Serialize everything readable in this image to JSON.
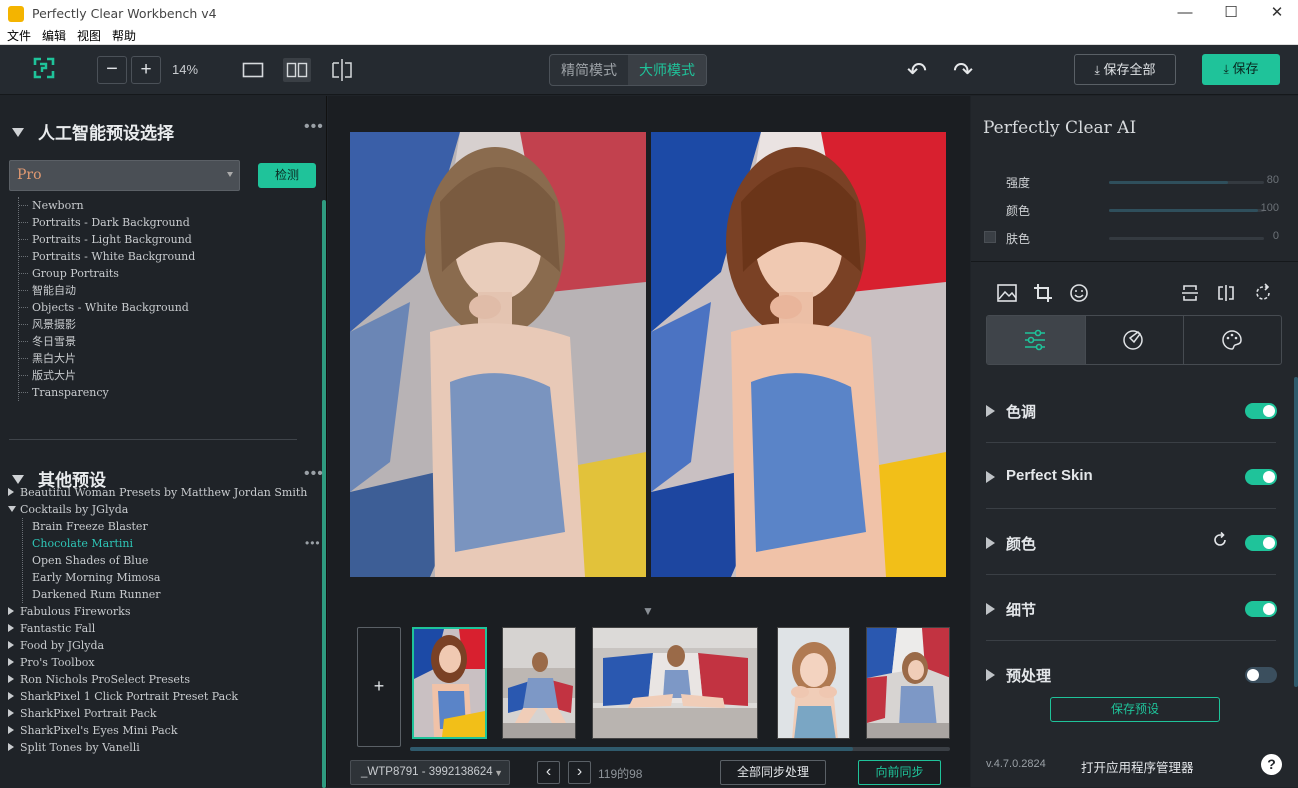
{
  "window": {
    "title": "Perfectly Clear Workbench v4",
    "minimize": "—",
    "maximize": "☐",
    "close": "✕"
  },
  "menu": [
    "文件",
    "编辑",
    "视图",
    "帮助"
  ],
  "toolbar": {
    "zoom_out": "−",
    "zoom_in": "+",
    "zoom_level": "14%",
    "mode_simple": "精简模式",
    "mode_master": "大师模式",
    "save_all": "保存全部",
    "save": "保存",
    "undo": "↶",
    "redo": "↷"
  },
  "left": {
    "ai_title": "人工智能预设选择",
    "preset_select": "Pro",
    "detect": "检测",
    "ai_presets": [
      "Newborn",
      "Portraits - Dark Background",
      "Portraits - Light Background",
      "Portraits - White Background",
      "Group Portraits",
      "智能自动",
      "Objects - White Background",
      "风景摄影",
      "冬日雪景",
      "黑白大片",
      "版式大片",
      "Transparency"
    ],
    "other_title": "其他预设",
    "groups_before": [
      "Beautiful Woman Presets by Matthew Jordan Smith"
    ],
    "expanded_group": "Cocktails by JGlyda",
    "expanded_items": [
      "Brain Freeze Blaster",
      "Chocolate Martini",
      "Open Shades of Blue",
      "Early Morning Mimosa",
      "Darkened Rum Runner"
    ],
    "groups_after": [
      "Fabulous Fireworks",
      "Fantastic Fall",
      "Food by JGlyda",
      "Pro's Toolbox",
      "Ron Nichols ProSelect Presets",
      "SharkPixel 1 Click Portrait Preset Pack",
      "SharkPixel Portrait Pack",
      "SharkPixel's Eyes Mini Pack",
      "Split Tones by Vanelli"
    ],
    "dots": "•••"
  },
  "center": {
    "add": "+",
    "file_select": "_WTP8791 - 3992138624",
    "prev": "‹",
    "next": "›",
    "counter": "119的98",
    "sync_all": "全部同步处理",
    "sync_forward": "向前同步",
    "collapse": "▼"
  },
  "right": {
    "title": "Perfectly Clear AI",
    "sliders": [
      {
        "label": "强度",
        "value": "80",
        "level": 0.8
      },
      {
        "label": "颜色",
        "value": "100",
        "level": 1.0
      },
      {
        "label": "肤色",
        "value": "0",
        "level": 0.0
      }
    ],
    "sections": [
      {
        "name": "色调",
        "on": true
      },
      {
        "name": "Perfect Skin",
        "on": true
      },
      {
        "name": "颜色",
        "on": true
      },
      {
        "name": "细节",
        "on": true
      },
      {
        "name": "预处理",
        "on": false
      }
    ],
    "save_preset": "保存预设",
    "version": "v.4.7.0.2824",
    "app_manager": "打开应用程序管理器",
    "help": "?"
  },
  "colors": {
    "accent": "#1fc39a",
    "toggle_off": "#3b4f5e",
    "selected_preset": "#2ec5b6"
  }
}
